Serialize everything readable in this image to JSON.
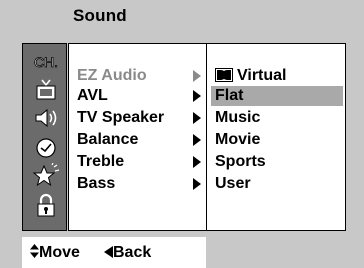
{
  "header": {
    "title": "Sound"
  },
  "sidebar": {
    "icons": [
      {
        "name": "channel-icon",
        "label": "CH."
      },
      {
        "name": "tv-icon"
      },
      {
        "name": "speaker-icon"
      },
      {
        "name": "clock-icon"
      },
      {
        "name": "star-icon"
      },
      {
        "name": "lock-icon"
      }
    ]
  },
  "menu": {
    "items": [
      {
        "label": "EZ Audio",
        "dim": true
      },
      {
        "label": "AVL"
      },
      {
        "label": "TV Speaker"
      },
      {
        "label": "Balance"
      },
      {
        "label": "Treble"
      },
      {
        "label": "Bass"
      }
    ]
  },
  "submenu": {
    "items": [
      {
        "label": "Virtual",
        "icon": "dolby-virtual-icon"
      },
      {
        "label": "Flat",
        "selected": true
      },
      {
        "label": "Music"
      },
      {
        "label": "Movie"
      },
      {
        "label": "Sports"
      },
      {
        "label": "User"
      }
    ]
  },
  "hints": {
    "move": "Move",
    "back": "Back"
  },
  "colors": {
    "frame": "#c8c8c8",
    "icon_column": "#6b6b6b",
    "selection": "#a9a9a9"
  }
}
